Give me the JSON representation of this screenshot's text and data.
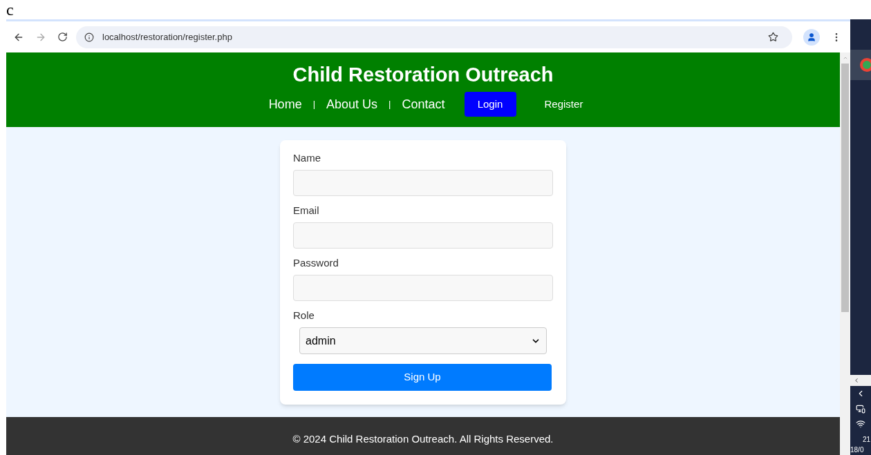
{
  "top_note": "c",
  "browser": {
    "url": "localhost/restoration/register.php"
  },
  "header": {
    "title": "Child Restoration Outreach",
    "nav": [
      {
        "kind": "link",
        "label": "Home"
      },
      {
        "kind": "separator",
        "label": "|"
      },
      {
        "kind": "link",
        "label": "About Us"
      },
      {
        "kind": "separator",
        "label": "|"
      },
      {
        "kind": "link",
        "label": "Contact"
      },
      {
        "kind": "button",
        "label": "Login"
      },
      {
        "kind": "small-link",
        "label": "Register"
      }
    ]
  },
  "form": {
    "fields": [
      {
        "kind": "text",
        "label": "Name"
      },
      {
        "kind": "text",
        "label": "Email"
      },
      {
        "kind": "text",
        "label": "Password"
      },
      {
        "kind": "select",
        "label": "Role",
        "value": "admin"
      }
    ],
    "submit": "Sign Up"
  },
  "footer": "© 2024 Child Restoration Outreach. All Rights Reserved.",
  "taskbar": {
    "time": "21",
    "date": "18/0"
  }
}
